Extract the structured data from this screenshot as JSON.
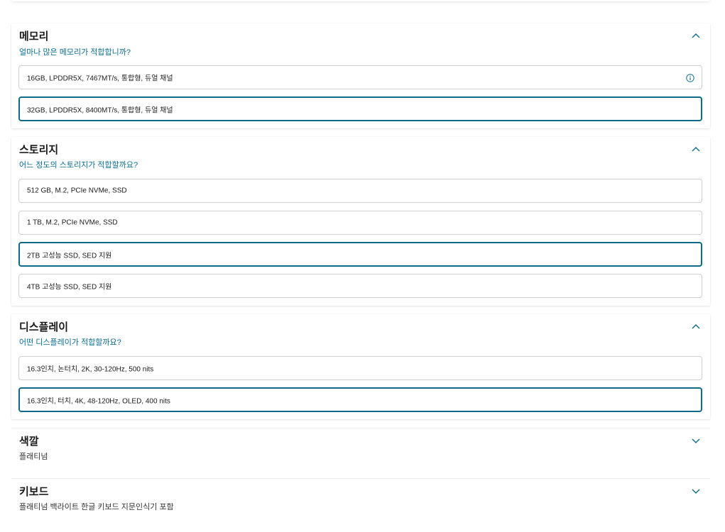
{
  "colors": {
    "accent": "#0e6a86",
    "subtitle": "#0a6d8f",
    "border": "#cfcfcf"
  },
  "memory": {
    "title": "메모리",
    "question": "얼마나 많은 메모리가 적합합니까?",
    "toggle_icon": "chevron-up-icon",
    "options": [
      {
        "label": "16GB, LPDDR5X, 7467MT/s, 통합형, 듀얼 채널",
        "selected": false,
        "icon": "info-icon"
      },
      {
        "label": "32GB, LPDDR5X, 8400MT/s, 통합형, 듀얼 채널",
        "selected": true
      }
    ]
  },
  "storage": {
    "title": "스토리지",
    "question": "어느 정도의 스토리지가 적합할까요?",
    "toggle_icon": "chevron-up-icon",
    "options": [
      {
        "label": "512 GB, M.2, PCIe NVMe, SSD",
        "selected": false
      },
      {
        "label": "1 TB, M.2, PCIe NVMe, SSD",
        "selected": false
      },
      {
        "label": "2TB 고성능 SSD, SED 지원",
        "selected": true
      },
      {
        "label": "4TB 고성능 SSD, SED 지원",
        "selected": false
      }
    ]
  },
  "display": {
    "title": "디스플레이",
    "question": "어떤 디스플레이가 적합할까요?",
    "toggle_icon": "chevron-up-icon",
    "options": [
      {
        "label": "16.3인치, 논터치, 2K, 30-120Hz, 500 nits",
        "selected": false
      },
      {
        "label": "16.3인치, 터치, 4K, 48-120Hz, OLED, 400 nits",
        "selected": true
      }
    ]
  },
  "color": {
    "title": "색깔",
    "value": "플래티넘",
    "toggle_icon": "chevron-down-icon"
  },
  "keyboard": {
    "title": "키보드",
    "value": "플래티넘 백라이트 한글 키보드 지문인식기 포함",
    "toggle_icon": "chevron-down-icon"
  }
}
